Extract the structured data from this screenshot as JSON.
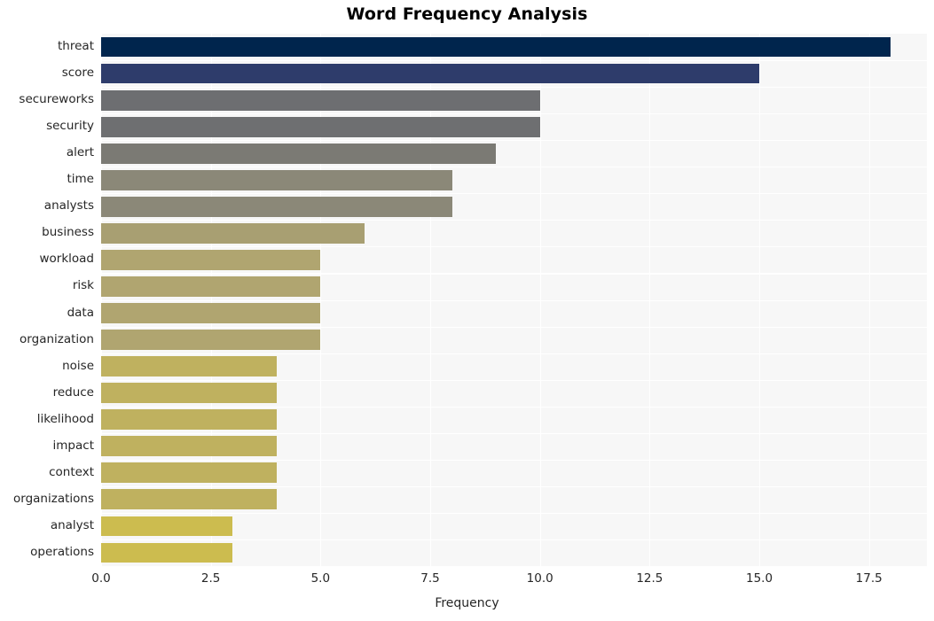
{
  "chart_data": {
    "type": "bar",
    "orientation": "horizontal",
    "title": "Word Frequency Analysis",
    "xlabel": "Frequency",
    "ylabel": "",
    "categories": [
      "threat",
      "score",
      "secureworks",
      "security",
      "alert",
      "time",
      "analysts",
      "business",
      "workload",
      "risk",
      "data",
      "organization",
      "noise",
      "reduce",
      "likelihood",
      "impact",
      "context",
      "organizations",
      "analyst",
      "operations"
    ],
    "values": [
      18,
      15,
      10,
      10,
      9,
      8,
      8,
      6,
      5,
      5,
      5,
      5,
      4,
      4,
      4,
      4,
      4,
      4,
      3,
      3
    ],
    "bar_colors": [
      "#00254d",
      "#2e3c6b",
      "#6d6e71",
      "#6e6f71",
      "#7b7a74",
      "#8b8878",
      "#8b8878",
      "#a89f72",
      "#b0a570",
      "#b0a570",
      "#b0a570",
      "#b0a570",
      "#bfb15f",
      "#bfb15f",
      "#bfb15f",
      "#bfb15f",
      "#bfb15f",
      "#bfb15f",
      "#ccbc4f",
      "#ccbc4f"
    ],
    "xlim": [
      0,
      18.82
    ],
    "xticks": [
      0.0,
      2.5,
      5.0,
      7.5,
      10.0,
      12.5,
      15.0,
      17.5
    ],
    "xtick_labels": [
      "0.0",
      "2.5",
      "5.0",
      "7.5",
      "10.0",
      "12.5",
      "15.0",
      "17.5"
    ],
    "grid": true,
    "grid_axis": "x",
    "legend": false,
    "plot_background": "#f7f7f7",
    "figure_background": "#ffffff",
    "tick_color": "#262626",
    "title_color": "#000000"
  }
}
